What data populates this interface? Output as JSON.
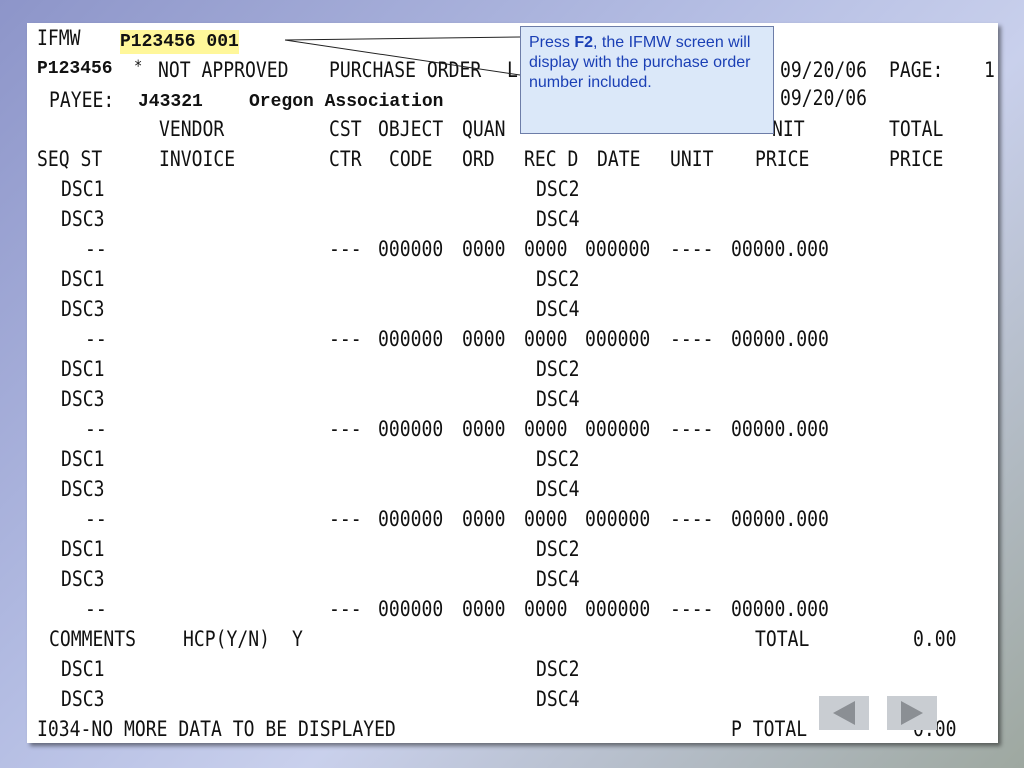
{
  "header": {
    "app": "IFMW",
    "po_input": "P123456 001",
    "po_id": "P123456",
    "asterisk": "*",
    "status": "NOT APPROVED",
    "title": "PURCHASE ORDER",
    "title_suffix": "L",
    "date1": "09/20/06",
    "page_label": "PAGE:",
    "page_num": "1",
    "payee_label": "PAYEE:",
    "payee_id": "J43321",
    "payee_name": "Oregon Association",
    "date2": "09/20/06"
  },
  "columns": {
    "row1": {
      "vendor": "VENDOR",
      "cst": "CST",
      "object": "OBJECT",
      "quan": "QUAN",
      "unit_part": "NIT",
      "total": "TOTAL"
    },
    "row2": {
      "seq_st": "SEQ ST",
      "invoice": "INVOICE",
      "ctr": "CTR",
      "code": "CODE",
      "ord": "ORD",
      "rec_d": "REC D",
      "date": "DATE",
      "unit": "UNIT",
      "price": "PRICE",
      "total_price": "PRICE"
    }
  },
  "lines": [
    {
      "dsc1": "DSC1",
      "dsc2": "DSC2",
      "dsc3": "DSC3",
      "dsc4": "DSC4",
      "seq": "--",
      "cst": "---",
      "object": "000000",
      "quan": "0000",
      "rec": "0000",
      "date": "000000",
      "unit": "----",
      "price": "00000.000"
    },
    {
      "dsc1": "DSC1",
      "dsc2": "DSC2",
      "dsc3": "DSC3",
      "dsc4": "DSC4",
      "seq": "--",
      "cst": "---",
      "object": "000000",
      "quan": "0000",
      "rec": "0000",
      "date": "000000",
      "unit": "----",
      "price": "00000.000"
    },
    {
      "dsc1": "DSC1",
      "dsc2": "DSC2",
      "dsc3": "DSC3",
      "dsc4": "DSC4",
      "seq": "--",
      "cst": "---",
      "object": "000000",
      "quan": "0000",
      "rec": "0000",
      "date": "000000",
      "unit": "----",
      "price": "00000.000"
    },
    {
      "dsc1": "DSC1",
      "dsc2": "DSC2",
      "dsc3": "DSC3",
      "dsc4": "DSC4",
      "seq": "--",
      "cst": "---",
      "object": "000000",
      "quan": "0000",
      "rec": "0000",
      "date": "000000",
      "unit": "----",
      "price": "00000.000"
    },
    {
      "dsc1": "DSC1",
      "dsc2": "DSC2",
      "dsc3": "DSC3",
      "dsc4": "DSC4",
      "seq": "--",
      "cst": "---",
      "object": "000000",
      "quan": "0000",
      "rec": "0000",
      "date": "000000",
      "unit": "----",
      "price": "00000.000"
    }
  ],
  "footer": {
    "comments": "COMMENTS",
    "hcp_label": "HCP(Y/N)",
    "hcp_value": "Y",
    "total_label": "TOTAL",
    "total_value": "0.00",
    "dsc1": "DSC1",
    "dsc2": "DSC2",
    "dsc3": "DSC3",
    "dsc4": "DSC4",
    "message": "I034-NO MORE DATA TO BE DISPLAYED",
    "ptotal_label": "P TOTAL",
    "ptotal_value": "0.00"
  },
  "callout": {
    "pre": "Press ",
    "key": "F2",
    "post": ", the IFMW screen will display with the purchase order number included."
  },
  "nav": {
    "prev_icon": "triangle-left-icon",
    "next_icon": "triangle-right-icon",
    "button_color": "#c9cdd2",
    "highlight_color": "#fff79a"
  }
}
